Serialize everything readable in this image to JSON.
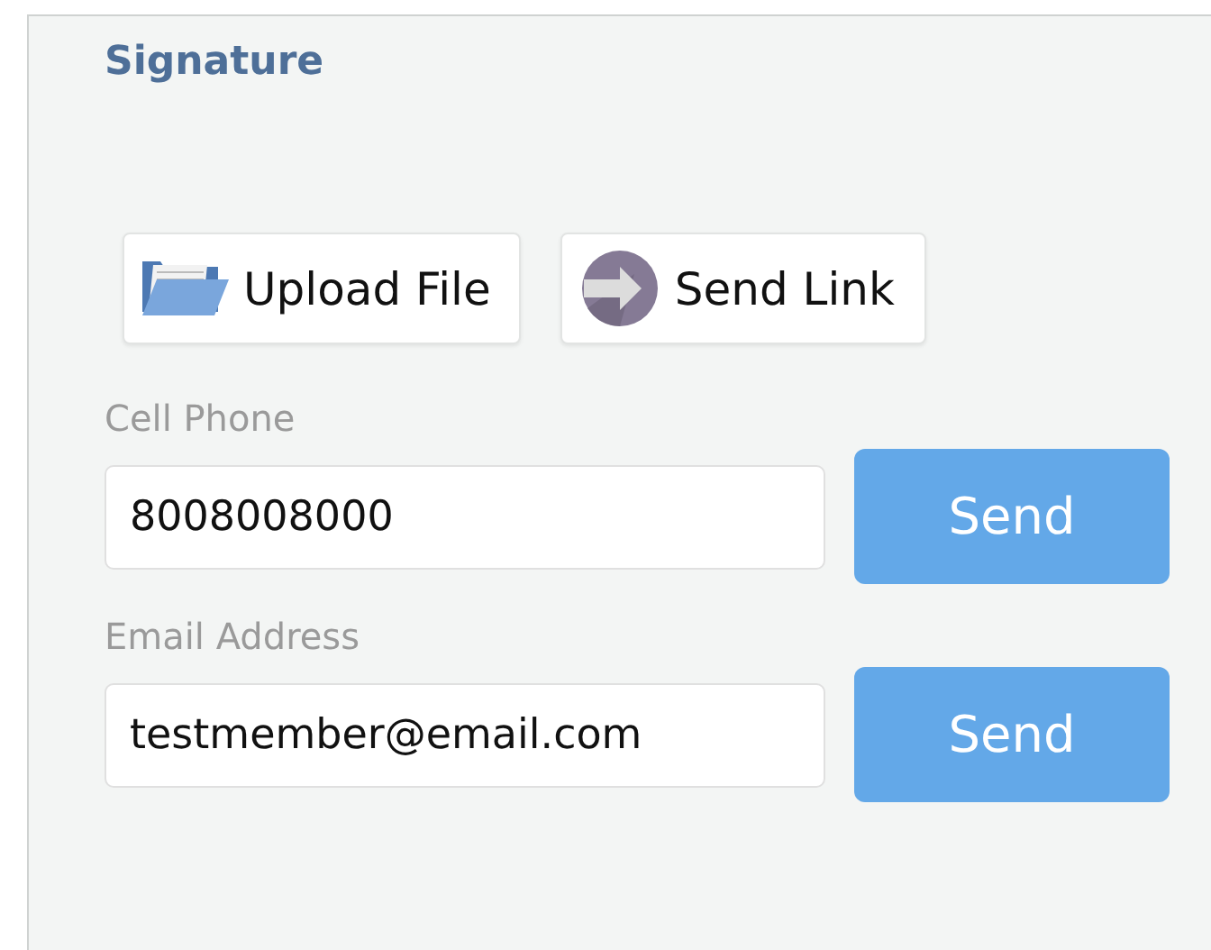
{
  "section": {
    "title": "Signature"
  },
  "actions": [
    {
      "kind": "upload",
      "label": "Upload File"
    },
    {
      "kind": "link",
      "label": "Send Link"
    }
  ],
  "fields": [
    {
      "label": "Cell Phone",
      "value": "8008008000",
      "button": "Send"
    },
    {
      "label": "Email Address",
      "value": "testmember@email.com",
      "button": "Send"
    }
  ]
}
